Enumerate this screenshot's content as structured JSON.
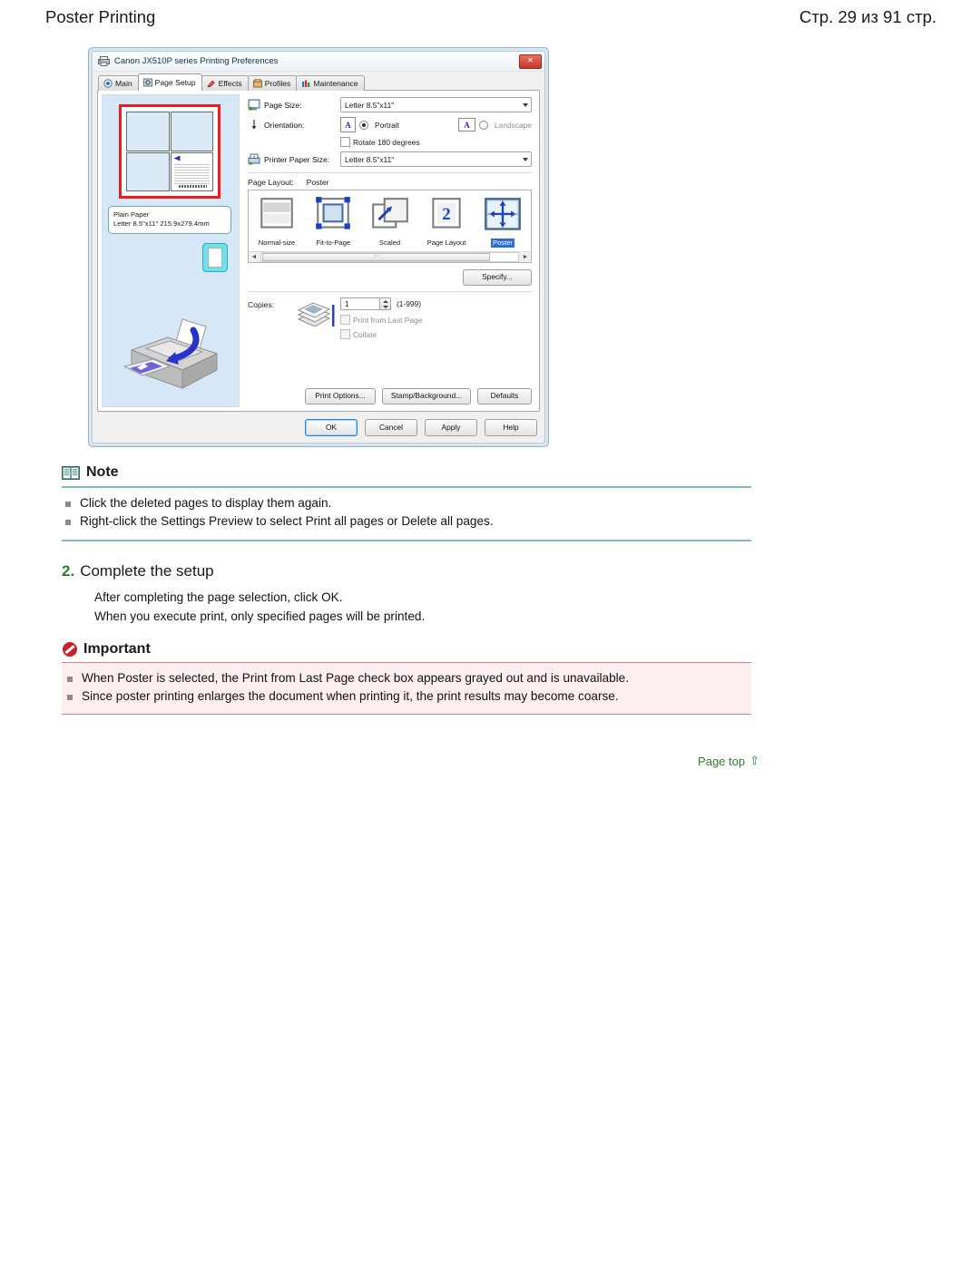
{
  "header": {
    "doc_title": "Poster Printing",
    "page_count": "Стр. 29 из 91 стр."
  },
  "dialog": {
    "title": "Canon JX510P series Printing Preferences",
    "title_icon": "printer-icon",
    "close_label": "✕",
    "tabs": [
      {
        "label": "Main",
        "icon": "main-icon",
        "active": false
      },
      {
        "label": "Page Setup",
        "icon": "page-setup-icon",
        "active": true
      },
      {
        "label": "Effects",
        "icon": "effects-icon",
        "active": false
      },
      {
        "label": "Profiles",
        "icon": "profiles-icon",
        "active": false
      },
      {
        "label": "Maintenance",
        "icon": "maintenance-icon",
        "active": false
      }
    ],
    "preview": {
      "paper_type": "Plain Paper",
      "paper_size": "Letter 8.5\"x11\" 215.9x279.4mm"
    },
    "fields": {
      "page_size_label": "Page Size:",
      "page_size_value": "Letter 8.5\"x11\"",
      "orientation_label": "Orientation:",
      "portrait_label": "Portrait",
      "landscape_label": "Landscape",
      "orientation_selected": "Portrait",
      "rotate_label": "Rotate 180 degrees",
      "rotate_checked": false,
      "printer_paper_size_label": "Printer Paper Size:",
      "printer_paper_size_value": "Letter 8.5\"x11\"",
      "orient_thumb_glyph": "A"
    },
    "page_layout": {
      "label": "Page Layout:",
      "value": "Poster",
      "items": [
        {
          "label": "Normal-size",
          "icon": "normal-size-icon",
          "selected": false
        },
        {
          "label": "Fit-to-Page",
          "icon": "fit-to-page-icon",
          "selected": false
        },
        {
          "label": "Scaled",
          "icon": "scaled-icon",
          "selected": false
        },
        {
          "label": "Page Layout",
          "icon": "page-layout-icon",
          "selected": false
        },
        {
          "label": "Poster",
          "icon": "poster-icon",
          "selected": true
        }
      ],
      "scroll_left": "◄",
      "scroll_right": "►",
      "scroll_thumb": "⋯"
    },
    "specify_button": "Specify...",
    "copies": {
      "label": "Copies:",
      "value": "1",
      "range": "(1-999)",
      "print_from_last_page_label": "Print from Last Page",
      "print_from_last_page_disabled": true,
      "collate_label": "Collate",
      "collate_disabled": true
    },
    "buttons": {
      "print_options": "Print Options...",
      "stamp_background": "Stamp/Background...",
      "defaults": "Defaults",
      "ok": "OK",
      "cancel": "Cancel",
      "apply": "Apply",
      "help": "Help"
    }
  },
  "note": {
    "icon": "book-icon",
    "title": "Note",
    "items": [
      "Click the deleted pages to display them again.",
      "Right-click the Settings Preview to select Print all pages or Delete all pages."
    ]
  },
  "step": {
    "number": "2.",
    "title": "Complete the setup",
    "lines": [
      "After completing the page selection, click OK.",
      "When you execute print, only specified pages will be printed."
    ]
  },
  "important": {
    "icon": "no-entry-icon",
    "title": "Important",
    "items": [
      "When Poster is selected, the Print from Last Page check box appears grayed out and is unavailable.",
      "Since poster printing enlarges the document when printing it, the print results may become coarse."
    ]
  },
  "page_top": {
    "label": "Page top",
    "arrow": "⇧"
  },
  "colors": {
    "accent_green": "#2e7d32",
    "note_rule": "#7dbdbd",
    "important_bg": "#fdeef0",
    "important_rule": "#d4818a",
    "selection_blue": "#2a6fd6",
    "preview_border_red": "#ee1c1c"
  }
}
